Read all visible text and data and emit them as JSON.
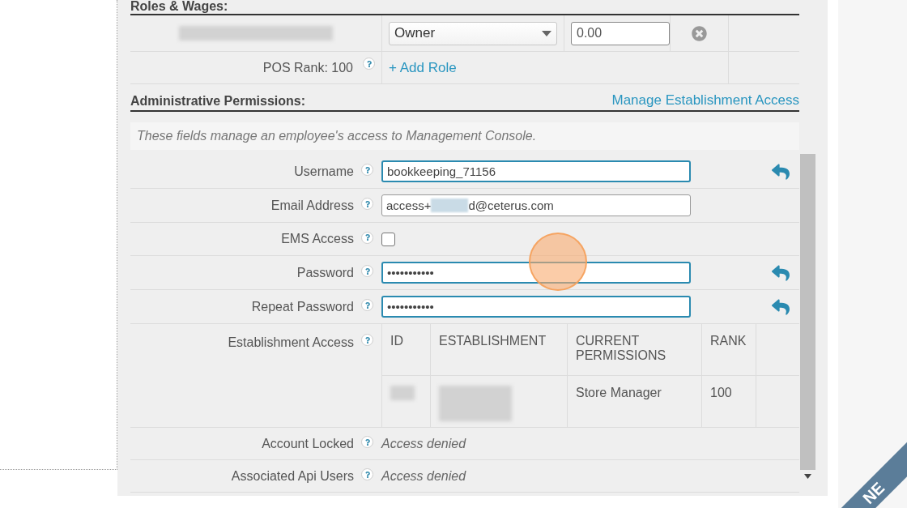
{
  "roles_section": {
    "title": "Roles & Wages:",
    "roles": [
      {
        "role": "Owner",
        "wage": "0.00"
      }
    ],
    "pos_rank_label": "POS Rank: 100",
    "add_role_link": "+ Add Role"
  },
  "admin_section": {
    "title": "Administrative Permissions:",
    "manage_link": "Manage Establishment Access",
    "note": "These fields manage an employee's access to Management Console.",
    "fields": [
      {
        "kind": "text",
        "label": "Username",
        "value": "bookkeeping_71156",
        "highlighted": true,
        "undo": true
      },
      {
        "kind": "email",
        "label": "Email Address",
        "value_start": "access+",
        "value_end": "d@ceterus.com",
        "highlighted": false
      },
      {
        "kind": "checkbox",
        "label": "EMS Access",
        "checked": false
      },
      {
        "kind": "text",
        "label": "Password",
        "value": "•••••••••••",
        "highlighted": true,
        "undo": true
      },
      {
        "kind": "text",
        "label": "Repeat Password",
        "value": "•••••••••••",
        "highlighted": true,
        "undo": true
      },
      {
        "kind": "table",
        "label": "Establishment Access",
        "columns": [
          "ID",
          "ESTABLISHMENT",
          "CURRENT PERMISSIONS",
          "RANK"
        ],
        "rows": [
          {
            "current_permissions": "Store Manager",
            "rank": "100"
          }
        ]
      },
      {
        "kind": "readonly",
        "label": "Account Locked",
        "value": "Access denied"
      },
      {
        "kind": "readonly",
        "label": "Associated Api Users",
        "value": "Access denied"
      }
    ]
  },
  "ribbon": "NE"
}
